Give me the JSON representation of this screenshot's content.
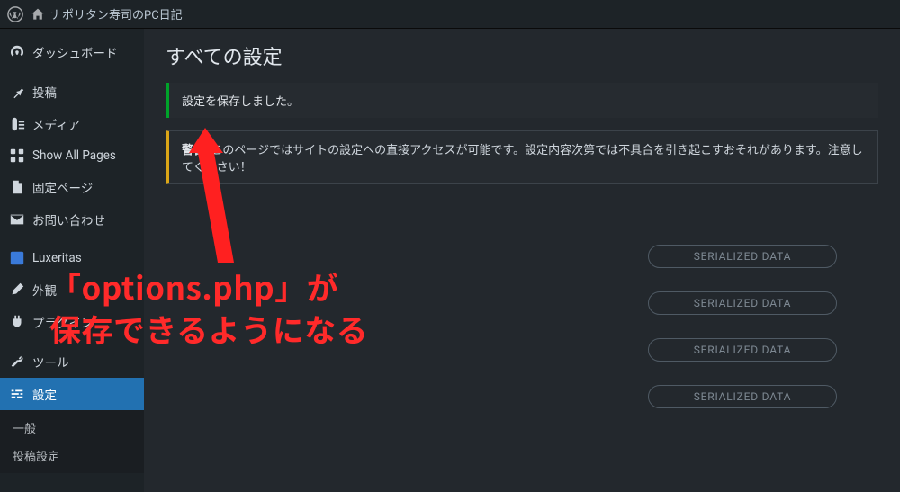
{
  "adminbar": {
    "site_title": "ナポリタン寿司のPC日記"
  },
  "sidebar": {
    "items": [
      {
        "icon": "dashboard",
        "label": "ダッシュボード"
      },
      {
        "icon": "pin",
        "label": "投稿"
      },
      {
        "icon": "media",
        "label": "メディア"
      },
      {
        "icon": "pages-all",
        "label": "Show All Pages"
      },
      {
        "icon": "page",
        "label": "固定ページ"
      },
      {
        "icon": "mail",
        "label": "お問い合わせ"
      },
      {
        "icon": "luxeritas",
        "label": "Luxeritas"
      },
      {
        "icon": "appearance",
        "label": "外観"
      },
      {
        "icon": "plugin",
        "label": "プラグイン"
      },
      {
        "icon": "tool",
        "label": "ツール"
      },
      {
        "icon": "settings",
        "label": "設定"
      }
    ],
    "submenu": [
      {
        "label": "一般"
      },
      {
        "label": "投稿設定"
      }
    ]
  },
  "main": {
    "page_title": "すべての設定",
    "success_notice": "設定を保存しました。",
    "warning_prefix": "警告",
    "warning_body": ": このページではサイトの設定への直接アクセスが可能です。設定内容次第では不具合を引き起こすおそれがあります。注意してください！"
  },
  "pills": {
    "label": "SERIALIZED DATA",
    "count": 4
  },
  "annotation": {
    "line1": "「options.php」が",
    "line2": "保存できるようになる"
  }
}
